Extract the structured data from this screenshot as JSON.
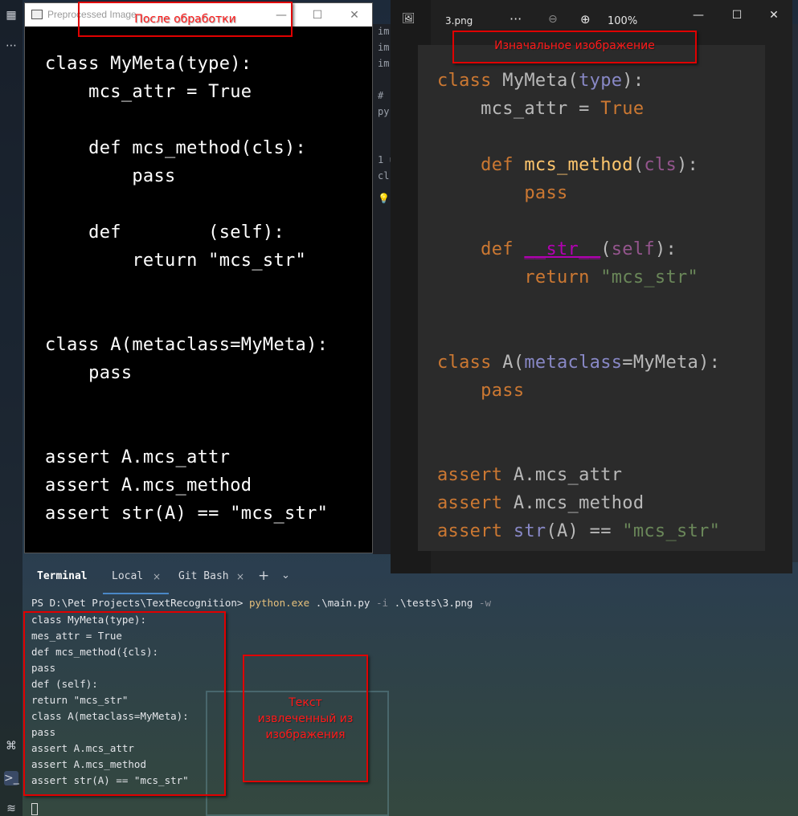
{
  "preprocessed_window": {
    "title": "Preprocessed Image",
    "code_lines": [
      "class MyMeta(type):",
      "    mcs_attr = True",
      "",
      "    def mcs_method(cls):",
      "        pass",
      "",
      "    def        (self):",
      "        return \"mcs_str\"",
      "",
      "",
      "class A(metaclass=MyMeta):",
      "    pass",
      "",
      "",
      "assert A.mcs_attr",
      "assert A.mcs_method",
      "assert str(A) == \"mcs_str\""
    ]
  },
  "viewer_window": {
    "filename": "3.png",
    "more": "···",
    "zoom_out_icon": "⊖",
    "zoom_in_icon": "⊕",
    "zoom": "100%",
    "code_tokens": {
      "l1_kw": "class",
      "l1_rest": " MyMeta(",
      "l1_b": "type",
      "l1_end": "):",
      "l2_a": "    mcs_attr = ",
      "l2_kw": "True",
      "l4_kw": "    def ",
      "l4_fn": "mcs_method",
      "l4_p": "(",
      "l4_s": "cls",
      "l4_e": "):",
      "l5": "        pass",
      "l7_kw": "    def ",
      "l7_fn": "__str__",
      "l7_p": "(",
      "l7_s": "self",
      "l7_e": "):",
      "l8_kw": "        return ",
      "l8_str": "\"mcs_str\"",
      "l11_kw": "class",
      "l11_a": " A(",
      "l11_m": "metaclass",
      "l11_e": "=MyMeta):",
      "l12": "    pass",
      "l15_kw": "assert",
      "l15_r": " A.mcs_attr",
      "l16_kw": "assert",
      "l16_r": " A.mcs_method",
      "l17_kw": "assert",
      "l17_b": " str",
      "l17_r": "(A) == ",
      "l17_s": "\"mcs_str\""
    }
  },
  "annotations": {
    "after_processing": "После обработки",
    "original_image": "Изначальное изображение",
    "extracted_text": "Текст извлеченный из изображения"
  },
  "terminal": {
    "title": "Terminal",
    "tabs": [
      "Local",
      "Git Bash"
    ],
    "close_icon": "×",
    "plus_icon": "+",
    "chevron_icon": "⌄",
    "prompt": "PS D:\\Pet Projects\\TextRecognition> ",
    "cmd_exe": "python.exe",
    "cmd_script": " .\\main.py ",
    "cmd_flag_i": "-i",
    "cmd_path": " .\\tests\\3.png ",
    "cmd_flag_w": "-w",
    "output_lines": [
      "class MyMeta(type):",
      "mes_attr = True",
      "def mcs_method({cls):",
      "pass",
      "def (self):",
      "return \"mcs_str\"",
      "class A(metaclass=MyMeta):",
      "pass",
      "assert A.mcs_attr",
      "assert A.mcs_method",
      "assert str(A) == \"mcs_str\""
    ]
  },
  "bg_editor": {
    "lines": [
      "im",
      "im",
      "im",
      "",
      "#",
      "py",
      "",
      "1 u",
      "cl"
    ]
  },
  "colors": {
    "annotation": "#e00000",
    "keyword": "#cc7832",
    "function": "#ffc66d",
    "string": "#6a8759"
  }
}
